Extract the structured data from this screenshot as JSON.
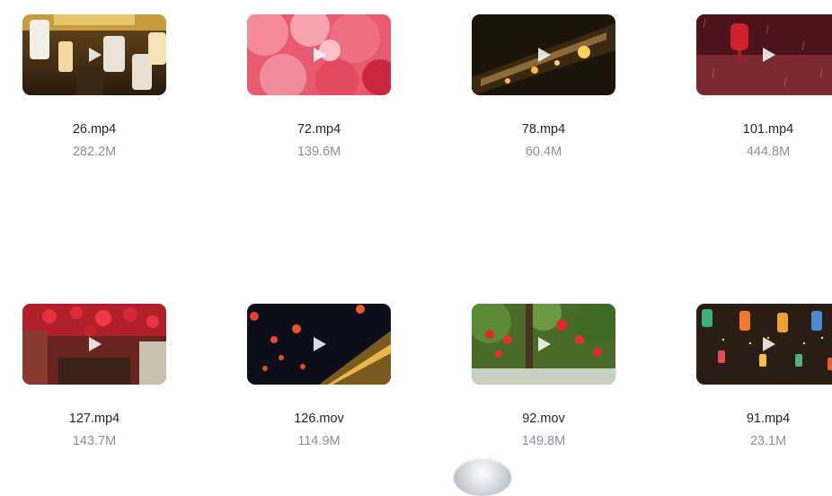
{
  "files": [
    {
      "name": "26.mp4",
      "size": "282.2M",
      "icon": "video-thumbnail",
      "scene": "lanterns-arcade"
    },
    {
      "name": "72.mp4",
      "size": "139.6M",
      "icon": "video-thumbnail",
      "scene": "pink-blossoms"
    },
    {
      "name": "78.mp4",
      "size": "60.4M",
      "icon": "video-thumbnail",
      "scene": "night-eaves"
    },
    {
      "name": "101.mp4",
      "size": "444.8M",
      "icon": "video-thumbnail",
      "scene": "red-lantern-rain"
    },
    {
      "name": "127.mp4",
      "size": "143.7M",
      "icon": "video-thumbnail",
      "scene": "lantern-street"
    },
    {
      "name": "126.mov",
      "size": "114.9M",
      "icon": "video-thumbnail",
      "scene": "night-lanterns-building"
    },
    {
      "name": "92.mov",
      "size": "149.8M",
      "icon": "video-thumbnail",
      "scene": "tree-lanterns"
    },
    {
      "name": "91.mp4",
      "size": "23.1M",
      "icon": "video-thumbnail",
      "scene": "festival-lanterns"
    }
  ],
  "colors": {
    "filename": "#1f2329",
    "filesize": "#8a8f99",
    "background": "#ffffff"
  }
}
